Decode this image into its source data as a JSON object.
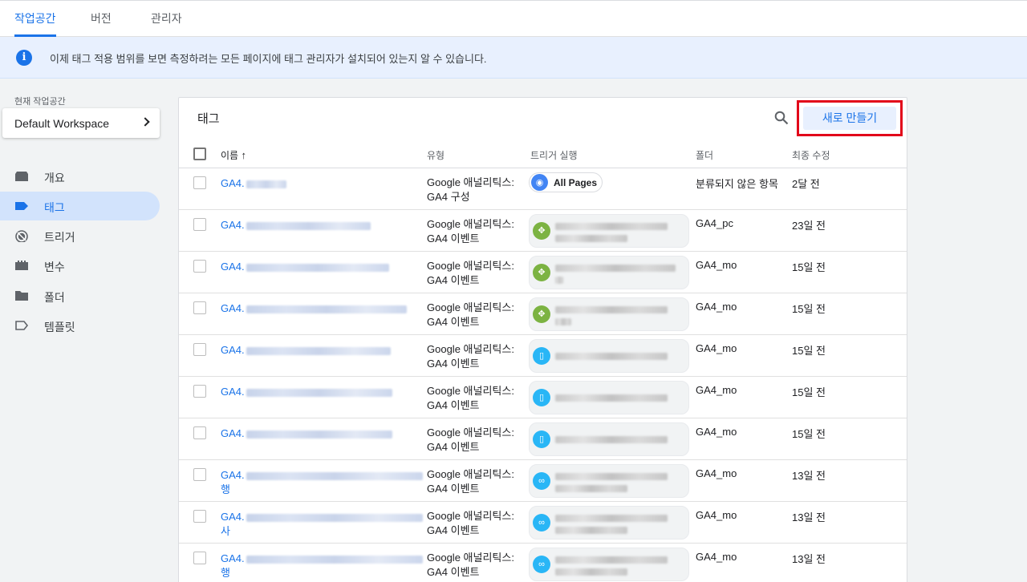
{
  "top_tabs": [
    {
      "label": "작업공간",
      "active": true
    },
    {
      "label": "버전",
      "active": false
    },
    {
      "label": "관리자",
      "active": false
    }
  ],
  "banner": {
    "icon": "info-icon",
    "icon_glyph": "i",
    "message": "이제 태그 적용 범위를 보면 측정하려는 모든 페이지에 태그 관리자가 설치되어 있는지 알 수 있습니다."
  },
  "workspace": {
    "label": "현재 작업공간",
    "name": "Default Workspace"
  },
  "sidebar": {
    "items": [
      {
        "label": "개요",
        "icon": "overview-icon",
        "active": false
      },
      {
        "label": "태그",
        "icon": "tag-icon",
        "active": true
      },
      {
        "label": "트리거",
        "icon": "trigger-icon",
        "active": false
      },
      {
        "label": "변수",
        "icon": "variable-icon",
        "active": false
      },
      {
        "label": "폴더",
        "icon": "folder-icon",
        "active": false
      },
      {
        "label": "템플릿",
        "icon": "template-icon",
        "active": false
      }
    ]
  },
  "card": {
    "title": "태그",
    "new_button": "새로 만들기",
    "columns": {
      "name": "이름",
      "sort_arrow": "↑",
      "type": "유형",
      "trigger": "트리거 실행",
      "folder": "폴더",
      "modified": "최종 수정"
    }
  },
  "rows": [
    {
      "name": "GA4.",
      "name_line2": "",
      "type_line1": "Google 애널리틱스:",
      "type_line2": "GA4 구성",
      "trigger_label": "All Pages",
      "trigger_icon": "eye-icon",
      "trigger_color": "#4285f4",
      "folder": "분류되지 않은 항목",
      "modified": "2달 전"
    },
    {
      "name": "GA4.",
      "name_line2": "",
      "type_line1": "Google 애널리틱스:",
      "type_line2": "GA4 이벤트",
      "trigger_label": "",
      "trigger_icon": "click-icon",
      "trigger_color": "#7cb342",
      "folder": "GA4_pc",
      "modified": "23일 전"
    },
    {
      "name": "GA4.",
      "name_line2": "",
      "type_line1": "Google 애널리틱스:",
      "type_line2": "GA4 이벤트",
      "trigger_label": "",
      "trigger_icon": "click-icon",
      "trigger_color": "#7cb342",
      "folder": "GA4_mo",
      "modified": "15일 전"
    },
    {
      "name": "GA4.",
      "name_line2": "",
      "type_line1": "Google 애널리틱스:",
      "type_line2": "GA4 이벤트",
      "trigger_label": "",
      "trigger_icon": "click-icon",
      "trigger_color": "#7cb342",
      "folder": "GA4_mo",
      "modified": "15일 전"
    },
    {
      "name": "GA4.",
      "name_line2": "",
      "type_line1": "Google 애널리틱스:",
      "type_line2": "GA4 이벤트",
      "trigger_label": "",
      "trigger_icon": "mouse-icon",
      "trigger_color": "#29b6f6",
      "folder": "GA4_mo",
      "modified": "15일 전"
    },
    {
      "name": "GA4.",
      "name_line2": "",
      "type_line1": "Google 애널리틱스:",
      "type_line2": "GA4 이벤트",
      "trigger_label": "",
      "trigger_icon": "mouse-icon",
      "trigger_color": "#29b6f6",
      "folder": "GA4_mo",
      "modified": "15일 전"
    },
    {
      "name": "GA4.",
      "name_line2": "",
      "type_line1": "Google 애널리틱스:",
      "type_line2": "GA4 이벤트",
      "trigger_label": "",
      "trigger_icon": "mouse-icon",
      "trigger_color": "#29b6f6",
      "folder": "GA4_mo",
      "modified": "15일 전"
    },
    {
      "name": "GA4.",
      "name_line2": "행",
      "type_line1": "Google 애널리틱스:",
      "type_line2": "GA4 이벤트",
      "trigger_label": "",
      "trigger_icon": "link-icon",
      "trigger_color": "#29b6f6",
      "folder": "GA4_mo",
      "modified": "13일 전"
    },
    {
      "name": "GA4.",
      "name_line2": "사",
      "type_line1": "Google 애널리틱스:",
      "type_line2": "GA4 이벤트",
      "trigger_label": "",
      "trigger_icon": "link-icon",
      "trigger_color": "#29b6f6",
      "folder": "GA4_mo",
      "modified": "13일 전"
    },
    {
      "name": "GA4.",
      "name_line2": "행",
      "type_line1": "Google 애널리틱스:",
      "type_line2": "GA4 이벤트",
      "trigger_label": "",
      "trigger_icon": "link-icon",
      "trigger_color": "#29b6f6",
      "folder": "GA4_mo",
      "modified": "13일 전"
    }
  ]
}
